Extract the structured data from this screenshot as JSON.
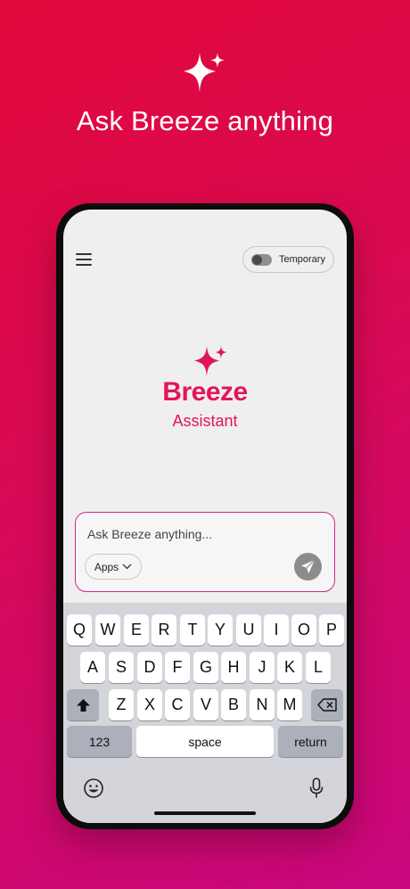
{
  "hero": {
    "title": "Ask Breeze anything"
  },
  "header": {
    "temporary_label": "Temporary"
  },
  "logo": {
    "word": "Breeze",
    "subtitle": "Assistant"
  },
  "composer": {
    "placeholder": "Ask Breeze anything...",
    "apps_label": "Apps"
  },
  "keyboard": {
    "row1": [
      "Q",
      "W",
      "E",
      "R",
      "T",
      "Y",
      "U",
      "I",
      "O",
      "P"
    ],
    "row2": [
      "A",
      "S",
      "D",
      "F",
      "G",
      "H",
      "J",
      "K",
      "L"
    ],
    "row3": [
      "Z",
      "X",
      "C",
      "V",
      "B",
      "N",
      "M"
    ],
    "numbers_label": "123",
    "space_label": "space",
    "return_label": "return"
  },
  "colors": {
    "brand": "#e31557",
    "background_start": "#e1083a",
    "background_end": "#c9077e",
    "composer_border": "#d6238a"
  },
  "icons": [
    "sparkle-icon",
    "menu-icon",
    "toggle-icon",
    "chevron-down-icon",
    "send-icon",
    "shift-icon",
    "backspace-icon",
    "emoji-icon",
    "microphone-icon"
  ]
}
